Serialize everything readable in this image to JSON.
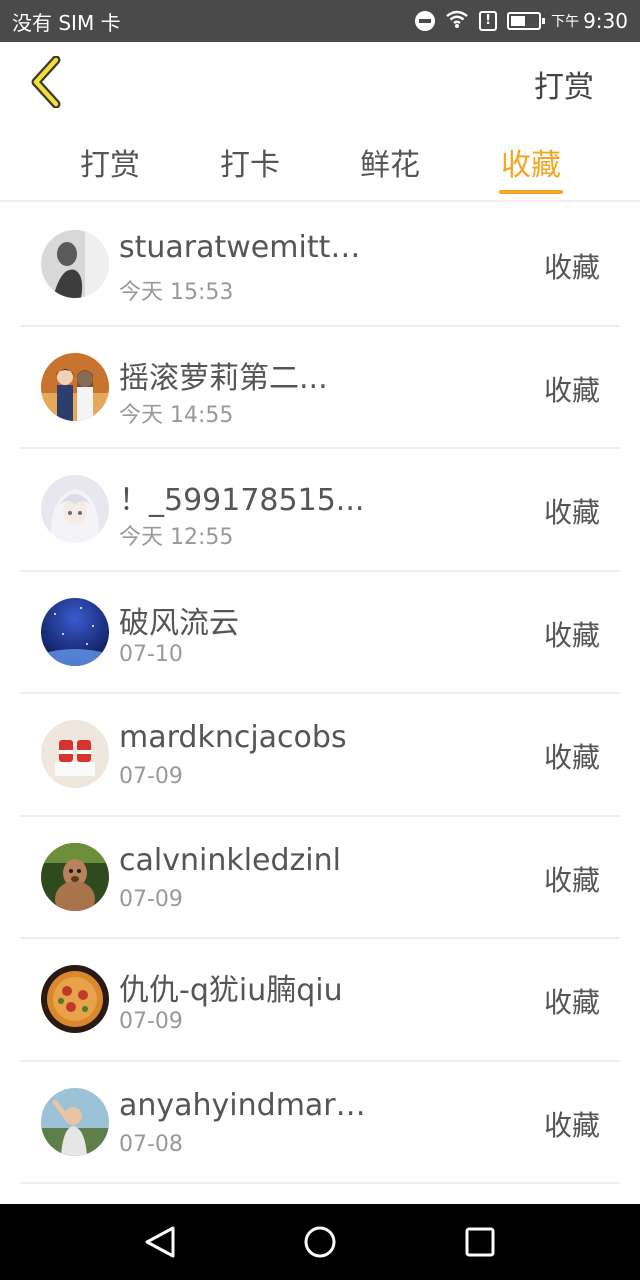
{
  "status_bar": {
    "carrier": "没有 SIM 卡",
    "time_prefix": "下午",
    "time": "9:30",
    "alert_mark": "!"
  },
  "header": {
    "title": "打赏"
  },
  "tabs": [
    {
      "label": "打赏",
      "active": false
    },
    {
      "label": "打卡",
      "active": false
    },
    {
      "label": "鲜花",
      "active": false
    },
    {
      "label": "收藏",
      "active": true
    }
  ],
  "accent_color": "#f5a623",
  "list": [
    {
      "name": "stuaratwemittz...",
      "date": "今天 15:53",
      "action": "收藏"
    },
    {
      "name": "摇滚萝莉第二...",
      "date": "今天 14:55",
      "action": "收藏"
    },
    {
      "name": "！_599178515...",
      "date": "今天 12:55",
      "action": "收藏"
    },
    {
      "name": "破风流云",
      "date": "07-10",
      "action": "收藏"
    },
    {
      "name": "mardkncjacobs",
      "date": "07-09",
      "action": "收藏"
    },
    {
      "name": "calvninkledzinl",
      "date": "07-09",
      "action": "收藏"
    },
    {
      "name": "仇仇-q犹iu腩qiu",
      "date": "07-09",
      "action": "收藏"
    },
    {
      "name": "anyahyindmarb...",
      "date": "07-08",
      "action": "收藏"
    }
  ]
}
